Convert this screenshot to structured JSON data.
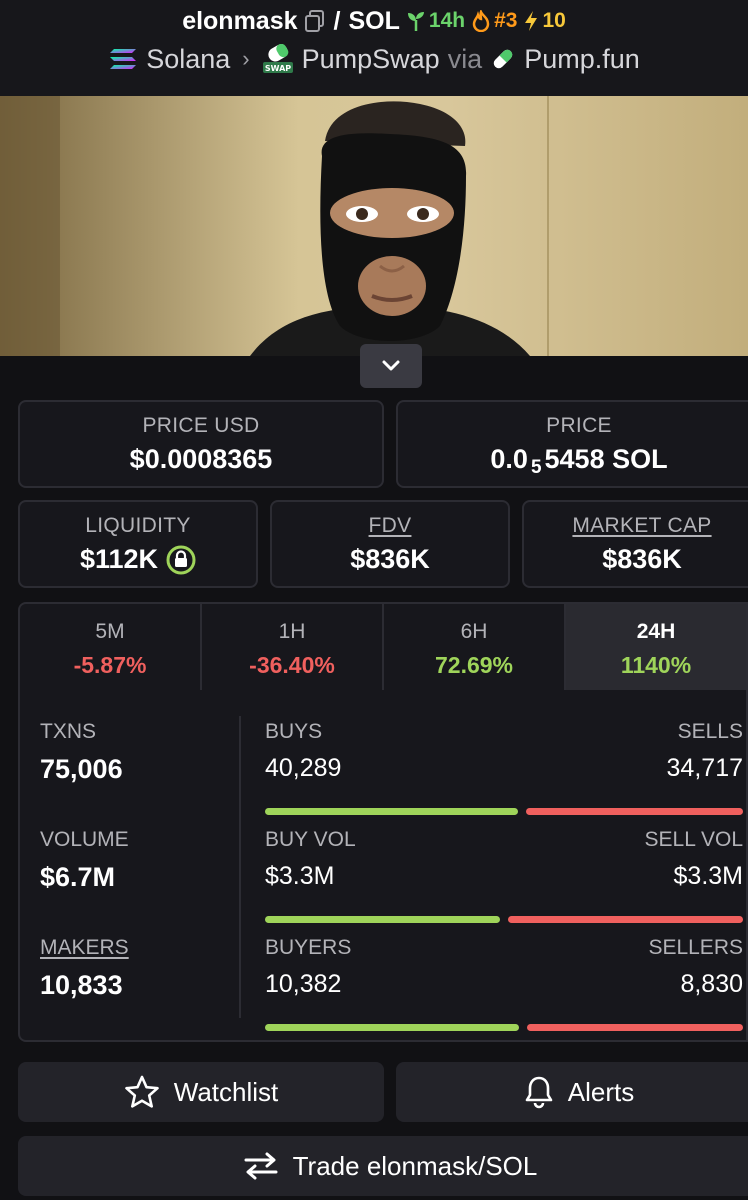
{
  "header": {
    "token_symbol": "elonmask",
    "separator": "/",
    "quote_symbol": "SOL",
    "age_badge": "14h",
    "rank_badge": "#3",
    "boost_badge": "10",
    "chain": "Solana",
    "dex": "PumpSwap",
    "via_label": "via",
    "launchpad": "Pump.fun",
    "icons": {
      "copy": "copy-icon",
      "age": "seedling-icon",
      "rank": "flame-icon",
      "boost": "lightning-icon",
      "chain": "solana-logo-icon",
      "dex": "pumpswap-logo-icon",
      "launchpad": "pill-icon",
      "breadcrumb": "chevron-right-icon"
    }
  },
  "banner": {
    "description_icon": "token-banner-image",
    "collapse_icon": "chevron-down-icon"
  },
  "price_cards": {
    "price_usd": {
      "label": "PRICE USD",
      "value": "$0.0008365"
    },
    "price_sol": {
      "label": "PRICE",
      "value_prefix": "0.0",
      "value_subscript": "5",
      "value_suffix": "5458 SOL"
    }
  },
  "metric_cards": {
    "liquidity": {
      "label": "LIQUIDITY",
      "value": "$112K",
      "icon": "lock-icon"
    },
    "fdv": {
      "label": "FDV",
      "value": "$836K"
    },
    "market_cap": {
      "label": "MARKET CAP",
      "value": "$836K"
    }
  },
  "timeframes": [
    {
      "label": "5M",
      "change": "-5.87%",
      "direction": "down"
    },
    {
      "label": "1H",
      "change": "-36.40%",
      "direction": "down"
    },
    {
      "label": "6H",
      "change": "72.69%",
      "direction": "up"
    },
    {
      "label": "24H",
      "change": "1140%",
      "direction": "up",
      "selected": true
    }
  ],
  "stats": {
    "txns": {
      "label": "TXNS",
      "value": "75,006"
    },
    "volume": {
      "label": "VOLUME",
      "value": "$6.7M"
    },
    "makers": {
      "label": "MAKERS",
      "value": "10,833"
    },
    "buys": {
      "label": "BUYS",
      "value": "40,289"
    },
    "sells": {
      "label": "SELLS",
      "value": "34,717"
    },
    "buys_ratio": 0.537,
    "buy_vol": {
      "label": "BUY VOL",
      "value": "$3.3M"
    },
    "sell_vol": {
      "label": "SELL VOL",
      "value": "$3.3M"
    },
    "vol_ratio": 0.5,
    "buyers": {
      "label": "BUYERS",
      "value": "10,382"
    },
    "sellers": {
      "label": "SELLERS",
      "value": "8,830"
    },
    "buyers_ratio": 0.54
  },
  "actions": {
    "watchlist": {
      "label": "Watchlist",
      "icon": "star-icon"
    },
    "alerts": {
      "label": "Alerts",
      "icon": "bell-icon"
    },
    "trade": {
      "label": "Trade elonmask/SOL",
      "icon": "swap-arrows-icon"
    }
  },
  "colors": {
    "background": "#111114",
    "card": "#17171c",
    "border": "#2c2c33",
    "positive": "#9fd45a",
    "negative": "#f0605e",
    "age_green": "#6bd36b",
    "rank_orange": "#ff9a1a",
    "boost_yellow": "#f7c83a"
  }
}
